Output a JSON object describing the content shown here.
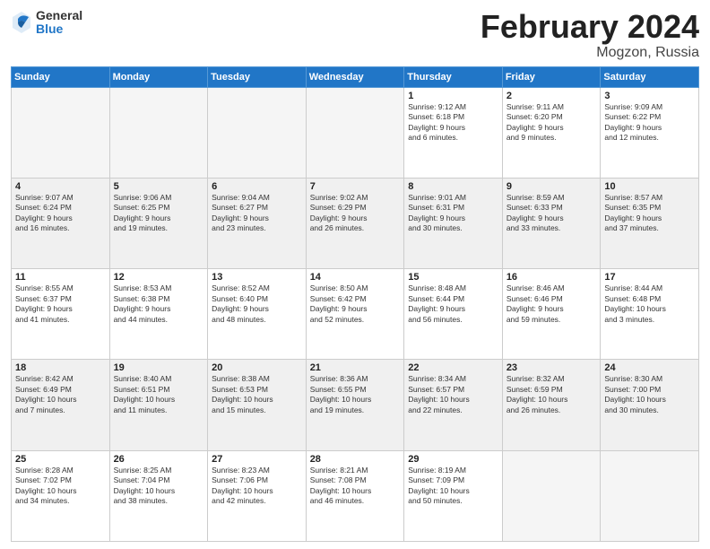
{
  "logo": {
    "general": "General",
    "blue": "Blue"
  },
  "title": {
    "month_year": "February 2024",
    "location": "Mogzon, Russia"
  },
  "weekdays": [
    "Sunday",
    "Monday",
    "Tuesday",
    "Wednesday",
    "Thursday",
    "Friday",
    "Saturday"
  ],
  "weeks": [
    [
      {
        "day": "",
        "info": ""
      },
      {
        "day": "",
        "info": ""
      },
      {
        "day": "",
        "info": ""
      },
      {
        "day": "",
        "info": ""
      },
      {
        "day": "1",
        "info": "Sunrise: 9:12 AM\nSunset: 6:18 PM\nDaylight: 9 hours\nand 6 minutes."
      },
      {
        "day": "2",
        "info": "Sunrise: 9:11 AM\nSunset: 6:20 PM\nDaylight: 9 hours\nand 9 minutes."
      },
      {
        "day": "3",
        "info": "Sunrise: 9:09 AM\nSunset: 6:22 PM\nDaylight: 9 hours\nand 12 minutes."
      }
    ],
    [
      {
        "day": "4",
        "info": "Sunrise: 9:07 AM\nSunset: 6:24 PM\nDaylight: 9 hours\nand 16 minutes."
      },
      {
        "day": "5",
        "info": "Sunrise: 9:06 AM\nSunset: 6:25 PM\nDaylight: 9 hours\nand 19 minutes."
      },
      {
        "day": "6",
        "info": "Sunrise: 9:04 AM\nSunset: 6:27 PM\nDaylight: 9 hours\nand 23 minutes."
      },
      {
        "day": "7",
        "info": "Sunrise: 9:02 AM\nSunset: 6:29 PM\nDaylight: 9 hours\nand 26 minutes."
      },
      {
        "day": "8",
        "info": "Sunrise: 9:01 AM\nSunset: 6:31 PM\nDaylight: 9 hours\nand 30 minutes."
      },
      {
        "day": "9",
        "info": "Sunrise: 8:59 AM\nSunset: 6:33 PM\nDaylight: 9 hours\nand 33 minutes."
      },
      {
        "day": "10",
        "info": "Sunrise: 8:57 AM\nSunset: 6:35 PM\nDaylight: 9 hours\nand 37 minutes."
      }
    ],
    [
      {
        "day": "11",
        "info": "Sunrise: 8:55 AM\nSunset: 6:37 PM\nDaylight: 9 hours\nand 41 minutes."
      },
      {
        "day": "12",
        "info": "Sunrise: 8:53 AM\nSunset: 6:38 PM\nDaylight: 9 hours\nand 44 minutes."
      },
      {
        "day": "13",
        "info": "Sunrise: 8:52 AM\nSunset: 6:40 PM\nDaylight: 9 hours\nand 48 minutes."
      },
      {
        "day": "14",
        "info": "Sunrise: 8:50 AM\nSunset: 6:42 PM\nDaylight: 9 hours\nand 52 minutes."
      },
      {
        "day": "15",
        "info": "Sunrise: 8:48 AM\nSunset: 6:44 PM\nDaylight: 9 hours\nand 56 minutes."
      },
      {
        "day": "16",
        "info": "Sunrise: 8:46 AM\nSunset: 6:46 PM\nDaylight: 9 hours\nand 59 minutes."
      },
      {
        "day": "17",
        "info": "Sunrise: 8:44 AM\nSunset: 6:48 PM\nDaylight: 10 hours\nand 3 minutes."
      }
    ],
    [
      {
        "day": "18",
        "info": "Sunrise: 8:42 AM\nSunset: 6:49 PM\nDaylight: 10 hours\nand 7 minutes."
      },
      {
        "day": "19",
        "info": "Sunrise: 8:40 AM\nSunset: 6:51 PM\nDaylight: 10 hours\nand 11 minutes."
      },
      {
        "day": "20",
        "info": "Sunrise: 8:38 AM\nSunset: 6:53 PM\nDaylight: 10 hours\nand 15 minutes."
      },
      {
        "day": "21",
        "info": "Sunrise: 8:36 AM\nSunset: 6:55 PM\nDaylight: 10 hours\nand 19 minutes."
      },
      {
        "day": "22",
        "info": "Sunrise: 8:34 AM\nSunset: 6:57 PM\nDaylight: 10 hours\nand 22 minutes."
      },
      {
        "day": "23",
        "info": "Sunrise: 8:32 AM\nSunset: 6:59 PM\nDaylight: 10 hours\nand 26 minutes."
      },
      {
        "day": "24",
        "info": "Sunrise: 8:30 AM\nSunset: 7:00 PM\nDaylight: 10 hours\nand 30 minutes."
      }
    ],
    [
      {
        "day": "25",
        "info": "Sunrise: 8:28 AM\nSunset: 7:02 PM\nDaylight: 10 hours\nand 34 minutes."
      },
      {
        "day": "26",
        "info": "Sunrise: 8:25 AM\nSunset: 7:04 PM\nDaylight: 10 hours\nand 38 minutes."
      },
      {
        "day": "27",
        "info": "Sunrise: 8:23 AM\nSunset: 7:06 PM\nDaylight: 10 hours\nand 42 minutes."
      },
      {
        "day": "28",
        "info": "Sunrise: 8:21 AM\nSunset: 7:08 PM\nDaylight: 10 hours\nand 46 minutes."
      },
      {
        "day": "29",
        "info": "Sunrise: 8:19 AM\nSunset: 7:09 PM\nDaylight: 10 hours\nand 50 minutes."
      },
      {
        "day": "",
        "info": ""
      },
      {
        "day": "",
        "info": ""
      }
    ]
  ]
}
